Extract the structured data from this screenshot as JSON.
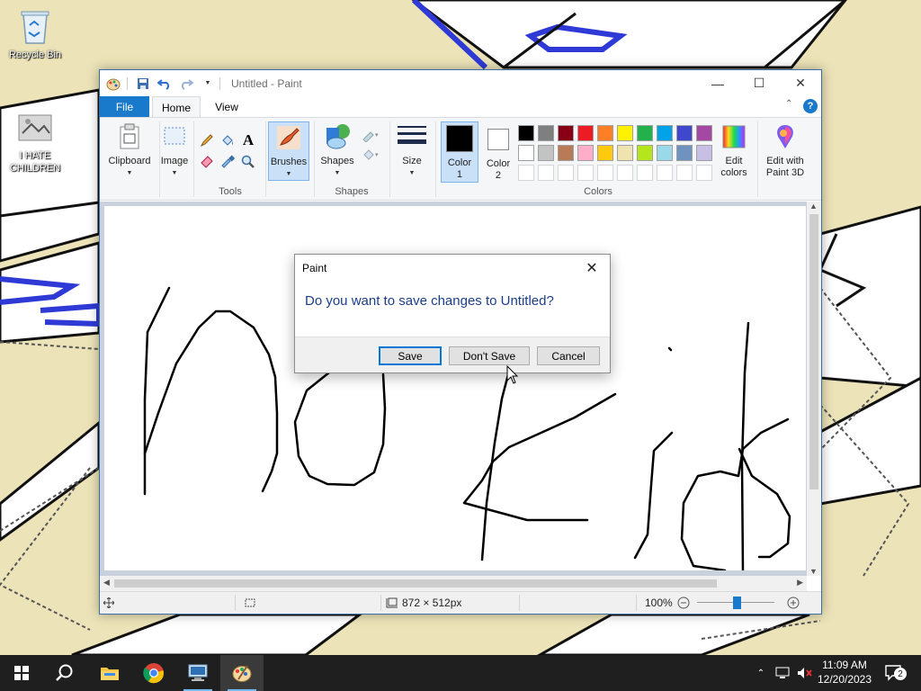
{
  "desktop": {
    "icons": [
      {
        "label": "Recycle Bin"
      },
      {
        "label": "I HATE CHILDREN"
      }
    ]
  },
  "paint": {
    "title": "Untitled - Paint",
    "tabs": {
      "file": "File",
      "home": "Home",
      "view": "View"
    },
    "ribbon": {
      "clipboard": "Clipboard",
      "image": "Image",
      "tools_label": "Tools",
      "brushes": "Brushes",
      "shapes": "Shapes",
      "shapes_group": "Shapes",
      "size": "Size",
      "color1": "Color\n1",
      "color2": "Color\n2",
      "colors_group": "Colors",
      "edit_colors": "Edit\ncolors",
      "edit_3d": "Edit with\nPaint 3D"
    },
    "palette_row1": [
      "#000000",
      "#7f7f7f",
      "#880015",
      "#ed1c24",
      "#ff7f27",
      "#fff200",
      "#22b14c",
      "#00a2e8",
      "#3f48cc",
      "#a349a4"
    ],
    "palette_row2": [
      "#ffffff",
      "#c3c3c3",
      "#b97a57",
      "#ffaec9",
      "#ffc90e",
      "#efe4b0",
      "#b5e61d",
      "#99d9ea",
      "#7092be",
      "#c8bfe7"
    ],
    "status": {
      "canvas_size": "872 × 512px",
      "zoom": "100%"
    }
  },
  "dialog": {
    "title": "Paint",
    "message": "Do you want to save changes to Untitled?",
    "save": "Save",
    "dont_save": "Don't Save",
    "cancel": "Cancel"
  },
  "taskbar": {
    "time": "11:09 AM",
    "date": "12/20/2023",
    "notifications": "2"
  },
  "colors": {
    "accent": "#1979ca",
    "taskbar": "#1f1f1f"
  }
}
